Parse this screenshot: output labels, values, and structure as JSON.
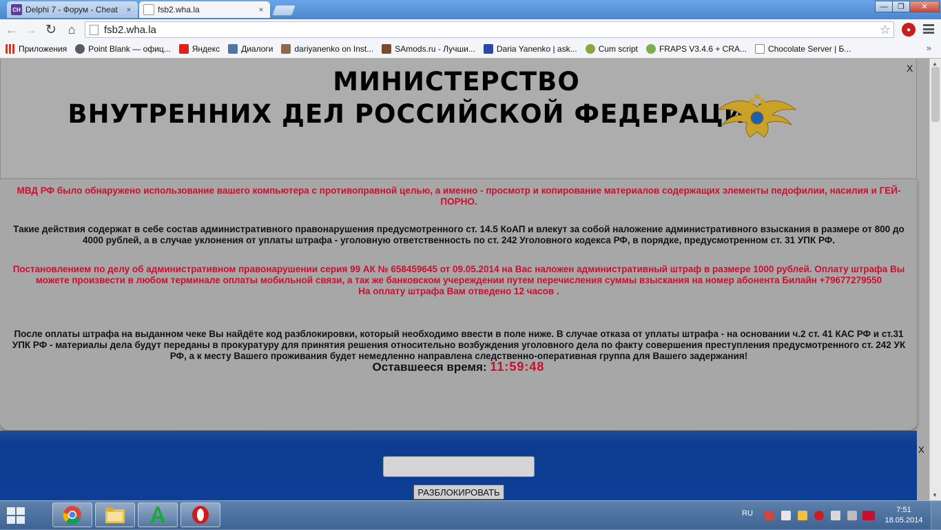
{
  "browser": {
    "tabs": [
      {
        "title": "Delphi 7 - Форум - Cheat",
        "active": false,
        "icon": "cheat-site-favicon"
      },
      {
        "title": "fsb2.wha.la",
        "active": true,
        "icon": "blank-page-favicon"
      }
    ],
    "tab_close_glyph": "×",
    "url": "fsb2.wha.la",
    "bookmarks": [
      {
        "label": "Приложения",
        "icon": "apps-grid-icon",
        "color": "#cc3a1f"
      },
      {
        "label": "Point Blank — офиц...",
        "icon": "point-blank-icon",
        "color": "#555a66"
      },
      {
        "label": "Яндекс",
        "icon": "yandex-icon",
        "color": "#e0201b"
      },
      {
        "label": "Диалоги",
        "icon": "vk-icon",
        "color": "#4a76a8"
      },
      {
        "label": "dariyanenko on Inst...",
        "icon": "instagram-icon",
        "color": "#8a6a4a"
      },
      {
        "label": "SAmods.ru - Лучши...",
        "icon": "samods-icon",
        "color": "#7a4a2a"
      },
      {
        "label": "Daria Yanenko | ask...",
        "icon": "ask-fm-icon",
        "color": "#2a4aa8"
      },
      {
        "label": "Cum script",
        "icon": "script-icon",
        "color": "#8aa83a"
      },
      {
        "label": "FRAPS V3.4.6 + CRA...",
        "icon": "fraps-icon",
        "color": "#7ab04a"
      },
      {
        "label": "Chocolate Server | Б...",
        "icon": "page-icon",
        "color": "#ffffff"
      }
    ],
    "bookmarks_more": "»",
    "window_controls": {
      "minimize": "—",
      "maximize": "❐",
      "close": "✕"
    }
  },
  "page": {
    "close_label": "X",
    "header": {
      "line1": "МИНИСТЕРСТВО",
      "line2": "ВНУТРЕННИХ ДЕЛ РОССИЙСКОЙ ФЕДЕРАЦИИ",
      "emblem": "double-headed-eagle-emblem"
    },
    "notice": {
      "p1": "МВД РФ было обнаружено использование вашего компьютера с противоправной целью, а именно - просмотр и копирование материалов содержащих элементы педофилии, насилия и ГЕЙ-ПОРНО.",
      "p2": "Такие действия содержат в себе состав административного правонарушения предусмотренного ст. 14.5 КоАП и влекут за собой наложение административного взыскания в размере от 800 до 4000 рублей, а в случае уклонения от уплаты штрафа - уголовную ответственность по ст. 242 Уголовного кодекса РФ, в порядке, предусмотренном ст. 31 УПК РФ.",
      "p3a": "Постановлением по делу об административном правонарушении серия 99 АК № 658459645 от 09.05.2014 на Вас наложен административный штраф в размере 1000 рублей. Оплату штрафа Вы можете произвести в любом терминале оплаты мобильной связи, а так же банковском учереждении путем перечисления суммы взыскания на номер абонента Билайн +79677279550",
      "p3b": "На оплату штрафа Вам отведено 12 часов .",
      "p4": "После оплаты штрафа на выданном чеке Вы найдёте код разблокировки, который необходимо ввести в поле ниже. В случае отказа от уплаты штрафа - на основании ч.2 ст. 41 КАС РФ и ст.31 УПК РФ - материалы дела будут переданы в прокуратуру для принятия решения относительно возбуждения уголовного дела по факту совершения преступления предусмотренного ст. 242 УК РФ, а к месту Вашего проживания будет немедленно направлена следственно-оперативная группа для Вашего задержания!",
      "timer_label": "Оставшееся время:",
      "timer_value": "11:59:48"
    },
    "unlock": {
      "input_value": "",
      "button_label": "РАЗБЛОКИРОВАТЬ",
      "panel_close": "X"
    },
    "colors": {
      "alert_red": "#c8102e",
      "panel_blue": "#0b3d91",
      "background_gray": "#a9a9a9"
    }
  },
  "taskbar": {
    "apps": [
      "chrome-icon",
      "file-explorer-icon",
      "green-a-app-icon",
      "opera-icon"
    ],
    "language": "RU",
    "time": "7:51",
    "date": "18.05.2014"
  }
}
